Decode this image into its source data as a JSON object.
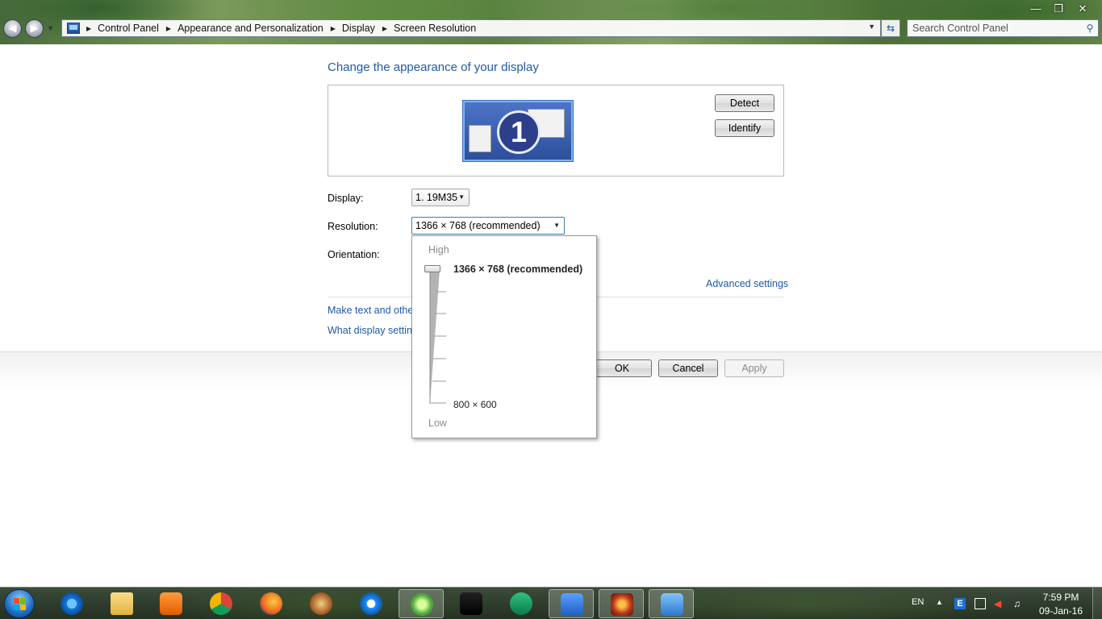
{
  "window": {
    "minimize_icon": "minimize-icon",
    "maximize_icon": "restore-icon",
    "close_icon": "close-icon"
  },
  "address_bar": {
    "breadcrumbs": [
      "Control Panel",
      "Appearance and Personalization",
      "Display",
      "Screen Resolution"
    ],
    "search_placeholder": "Search Control Panel"
  },
  "main": {
    "title": "Change the appearance of your display",
    "monitor_number": "1",
    "detect_label": "Detect",
    "identify_label": "Identify",
    "display_label": "Display:",
    "display_value": "1. 19M35",
    "resolution_label": "Resolution:",
    "resolution_value": "1366 × 768 (recommended)",
    "orientation_label": "Orientation:",
    "advanced_link": "Advanced settings",
    "link_text_size": "Make text and other",
    "link_what_settings": "What display setting",
    "ok_label": "OK",
    "cancel_label": "Cancel",
    "apply_label": "Apply"
  },
  "resolution_dropdown": {
    "high_label": "High",
    "low_label": "Low",
    "top_value": "1366 × 768 (recommended)",
    "bottom_value": "800 × 600",
    "slider_position_fraction": 1.0
  },
  "taskbar": {
    "apps": [
      {
        "name": "internet-explorer-icon"
      },
      {
        "name": "windows-explorer-icon"
      },
      {
        "name": "media-player-icon"
      },
      {
        "name": "chrome-icon"
      },
      {
        "name": "firefox-icon"
      },
      {
        "name": "app-icon"
      },
      {
        "name": "app-icon"
      },
      {
        "name": "app-icon"
      },
      {
        "name": "mu-game-icon"
      },
      {
        "name": "app-icon"
      },
      {
        "name": "download-app-icon"
      },
      {
        "name": "game-icon"
      },
      {
        "name": "control-panel-icon"
      }
    ],
    "language": "EN",
    "time": "7:59 PM",
    "date": "09-Jan-16"
  },
  "colors": {
    "link": "#1e5aa8",
    "title": "#1e5aa8"
  }
}
